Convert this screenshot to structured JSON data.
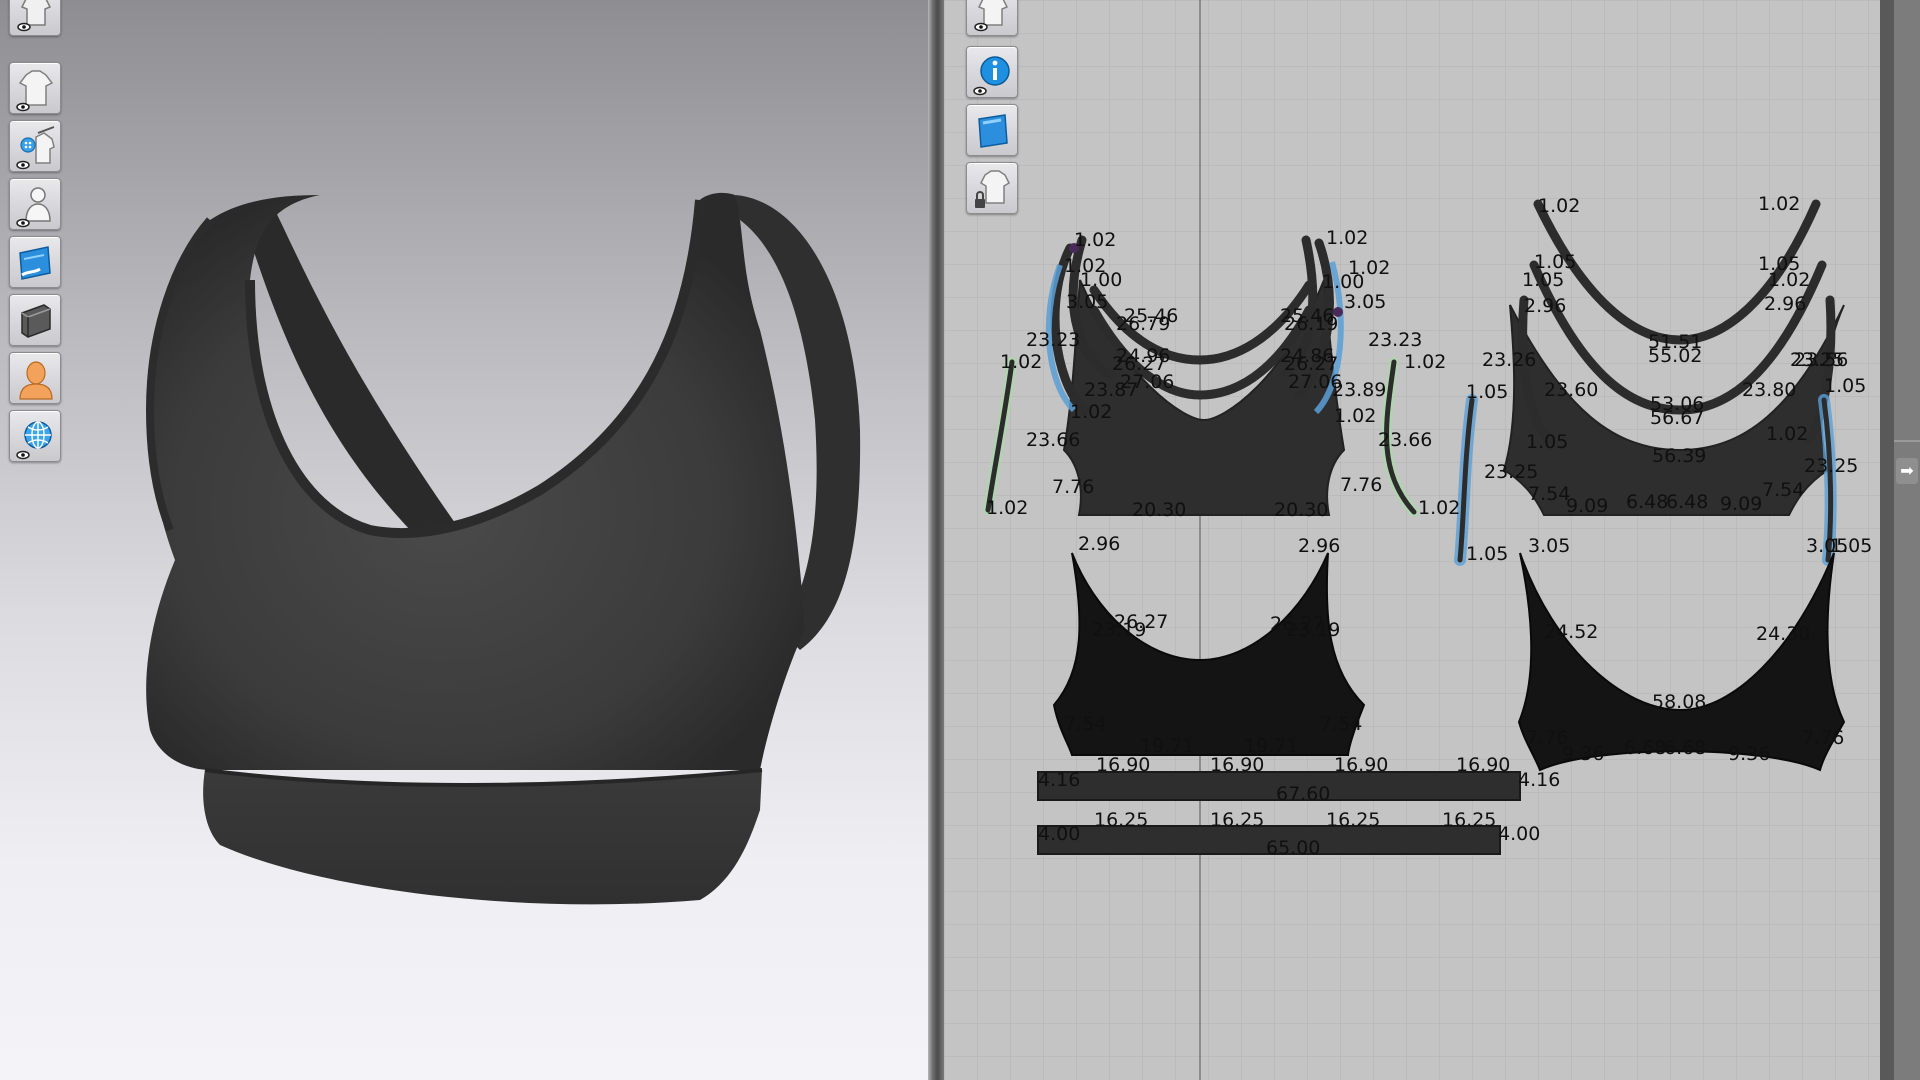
{
  "colors": {
    "fabric": "#3a3a3a",
    "fabric_dark": "#1e1e1e",
    "pattern_piece": "#2e2e2e",
    "pattern_piece_dark": "#161616",
    "seam_highlight": "#5b9fd6",
    "seam_green": "#a8dca8",
    "grid_bg": "#c4c4c4",
    "point_marker": "#4a2a5a"
  },
  "toolbar_3d": {
    "items": [
      {
        "id": "show-garment-3d",
        "icon": "shirt-eye-icon"
      },
      {
        "id": "show-garment",
        "icon": "shirt-eye-icon"
      },
      {
        "id": "show-trims",
        "icon": "button-shirt-eye-icon"
      },
      {
        "id": "show-avatar",
        "icon": "avatar-eye-icon"
      },
      {
        "id": "texture-mode",
        "icon": "fabric-swatch-icon"
      },
      {
        "id": "thickness-mode",
        "icon": "fabric-roll-icon"
      },
      {
        "id": "avatar-skin",
        "icon": "avatar-face-icon"
      },
      {
        "id": "environment",
        "icon": "globe-eye-icon"
      }
    ]
  },
  "toolbar_2d": {
    "items": [
      {
        "id": "show-pieces",
        "icon": "shirt-eye-icon"
      },
      {
        "id": "show-info",
        "icon": "info-icon"
      },
      {
        "id": "show-texture",
        "icon": "fabric-swatch-icon"
      },
      {
        "id": "lock-pieces",
        "icon": "shirt-lock-icon"
      }
    ]
  },
  "pattern_labels": {
    "front_strap_left": [
      "1.02",
      "1.02",
      "1.00",
      "3.05",
      "26.79",
      "25.46",
      "24.96",
      "26.27",
      "27.06",
      "23.87",
      "1.02",
      "23.23",
      "23.66"
    ],
    "front_strap_right": [
      "1.02",
      "1.02",
      "1.00",
      "3.05",
      "26.19",
      "25.46",
      "24.86",
      "26.27",
      "27.06",
      "23.89",
      "1.02",
      "23.23",
      "23.66"
    ],
    "front_side": [
      "1.02",
      "1.02",
      "1.02",
      "1.02"
    ],
    "front_lining": [
      "7.76",
      "20.30",
      "20.30",
      "7.76"
    ],
    "back_top": [
      "1.02",
      "1.02",
      "1.05",
      "1.05",
      "1.05",
      "1.02",
      "2.96",
      "2.96",
      "51.51",
      "55.02",
      "53.06",
      "56.67",
      "23.60",
      "23.80",
      "23.25",
      "23.56",
      "1.05",
      "1.02",
      "56.39"
    ],
    "back_side": [
      "1.05",
      "1.05",
      "23.26",
      "23.25",
      "1.05",
      "1.05",
      "23.25"
    ],
    "back_bottom": [
      "7.54",
      "9.09",
      "6.48",
      "6.48",
      "9.09",
      "7.54"
    ],
    "front_shell": [
      "2.96",
      "2.96",
      "26.27",
      "23.19",
      "26.27",
      "23.19",
      "7.54",
      "7.54",
      "19.71",
      "19.71"
    ],
    "back_shell": [
      "3.05",
      "3.05",
      "24.52",
      "24.30",
      "58.08",
      "7.76",
      "9.36",
      "6.68",
      "6.68",
      "9.36",
      "7.76"
    ],
    "band_outer": [
      "4.16",
      "16.90",
      "16.90",
      "16.90",
      "16.90",
      "4.16",
      "67.60"
    ],
    "band_inner": [
      "4.00",
      "16.25",
      "16.25",
      "16.25",
      "16.25",
      "4.00",
      "65.00"
    ]
  }
}
